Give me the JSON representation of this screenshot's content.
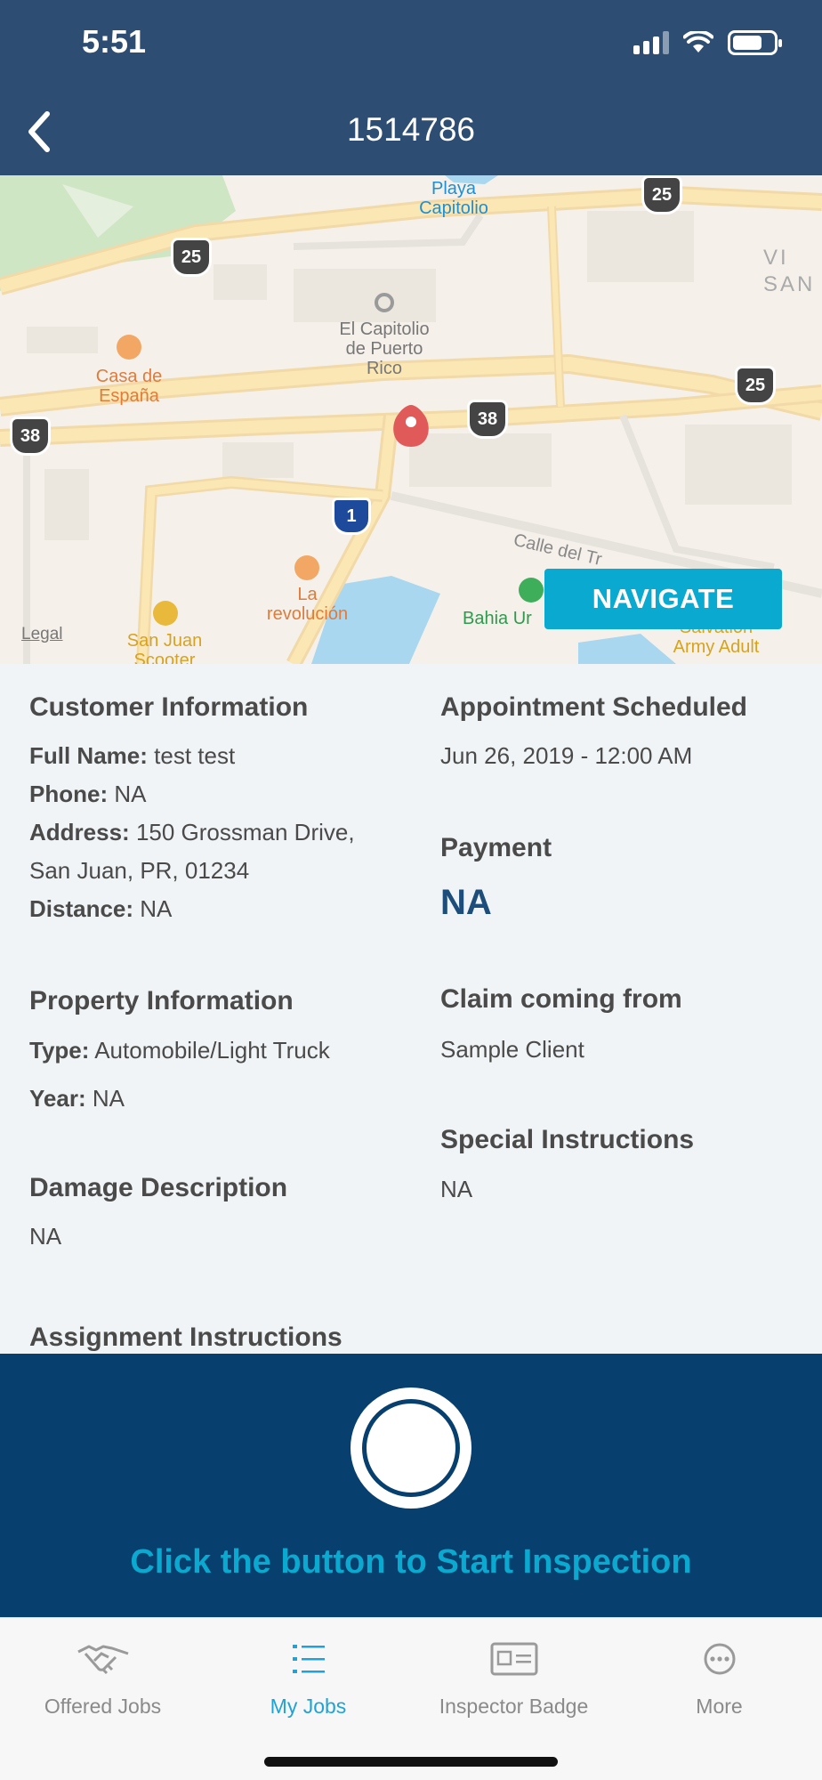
{
  "status_bar": {
    "time": "5:51",
    "battery_level": 0.72
  },
  "header": {
    "title": "1514786",
    "back_icon": "chevron-left-icon"
  },
  "map": {
    "navigate_label": "NAVIGATE",
    "legal_label": "Legal",
    "labels": {
      "playa": "Playa\nCapitolio",
      "capitolio": "El Capitolio\nde Puerto\nRico",
      "casa": "Casa de\nEspaña",
      "revolucion": "La\nrevolución",
      "bahia": "Bahia Ur",
      "sanjuan": "San Juan\nScooter",
      "calle": "Calle del Tr",
      "salvation": "Salvation\nArmy Adult",
      "vi": "VI\nSAN"
    },
    "shields": {
      "s25a": "25",
      "s25b": "25",
      "s25c": "25",
      "s38a": "38",
      "s38b": "38",
      "i1": "1"
    }
  },
  "customer": {
    "title": "Customer Information",
    "full_name_label": "Full Name:",
    "full_name": "test test",
    "phone_label": "Phone:",
    "phone": "NA",
    "address_label": "Address:",
    "address_line1": "150 Grossman Drive,",
    "address_line2": "San Juan, PR, 01234",
    "distance_label": "Distance:",
    "distance": "NA"
  },
  "appointment": {
    "title": "Appointment Scheduled",
    "value": "Jun 26, 2019 - 12:00 AM"
  },
  "payment": {
    "title": "Payment",
    "value": "NA"
  },
  "property": {
    "title": "Property Information",
    "type_label": "Type:",
    "type": "Automobile/Light Truck",
    "year_label": "Year:",
    "year": "NA"
  },
  "claim": {
    "title": "Claim coming from",
    "value": "Sample Client"
  },
  "special": {
    "title": "Special Instructions",
    "value": "NA"
  },
  "damage": {
    "title": "Damage Description",
    "value": "NA"
  },
  "assignment": {
    "title": "Assignment Instructions"
  },
  "inspection": {
    "prompt": "Click the button to Start Inspection"
  },
  "tabs": [
    {
      "label": "Offered Jobs",
      "icon": "handshake-icon",
      "active": false
    },
    {
      "label": "My Jobs",
      "icon": "list-icon",
      "active": true
    },
    {
      "label": "Inspector Badge",
      "icon": "id-card-icon",
      "active": false
    },
    {
      "label": "More",
      "icon": "more-icon",
      "active": false
    }
  ],
  "colors": {
    "header": "#2d4d72",
    "accent": "#0aa9cf",
    "panel": "#073f6e",
    "payment": "#1d4d7a"
  }
}
